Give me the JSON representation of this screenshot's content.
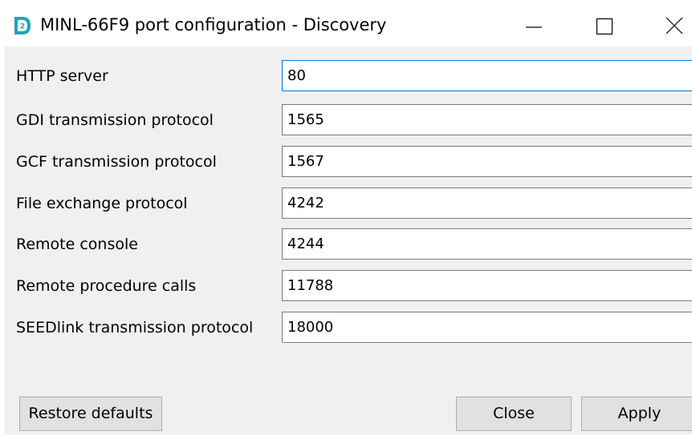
{
  "window": {
    "title": "MINL-66F9 port configuration - Discovery",
    "icon": "discovery-app-icon",
    "accent_color": "#1fa3b7",
    "controls": {
      "minimize_icon": "minimize-icon",
      "maximize_icon": "maximize-icon",
      "close_icon": "close-icon"
    }
  },
  "ports": [
    {
      "label": "HTTP server",
      "value": "80",
      "focused": true
    },
    {
      "label": "GDI transmission protocol",
      "value": "1565"
    },
    {
      "label": "GCF transmission protocol",
      "value": "1567"
    },
    {
      "label": "File exchange protocol",
      "value": "4242"
    },
    {
      "label": "Remote console",
      "value": "4244"
    },
    {
      "label": "Remote procedure calls",
      "value": "11788"
    },
    {
      "label": "SEEDlink transmission protocol",
      "value": "18000"
    }
  ],
  "footer": {
    "restore_label": "Restore defaults",
    "close_label": "Close",
    "apply_label": "Apply"
  }
}
